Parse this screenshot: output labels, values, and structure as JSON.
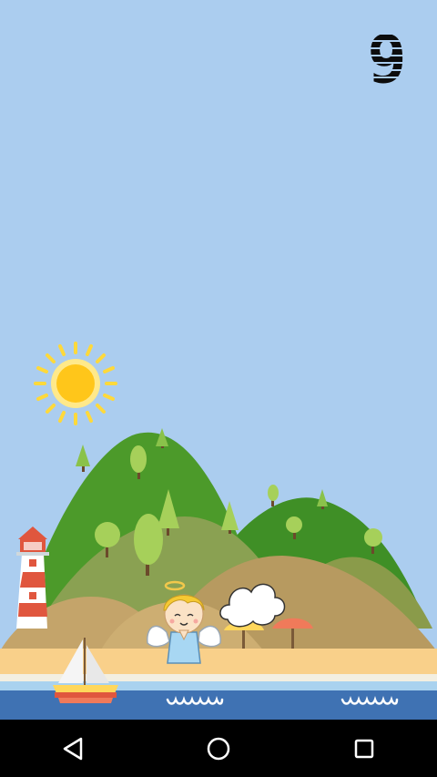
{
  "game": {
    "score": "9"
  },
  "colors": {
    "sky": "#abcdef",
    "sun": "#ffd93b",
    "hill_dark": "#4c9a2a",
    "hill_mid": "#8aa152",
    "hill_sand": "#c4a46a",
    "beach": "#f9d08a",
    "water": "#3f72b3",
    "lighthouse_red": "#e0563e",
    "umbrella_red": "#f07a5a",
    "umbrella_yellow": "#ffd75b",
    "navbar": "#000000"
  },
  "icons": {
    "back": "back-triangle-icon",
    "home": "home-circle-icon",
    "recents": "recents-square-icon"
  }
}
